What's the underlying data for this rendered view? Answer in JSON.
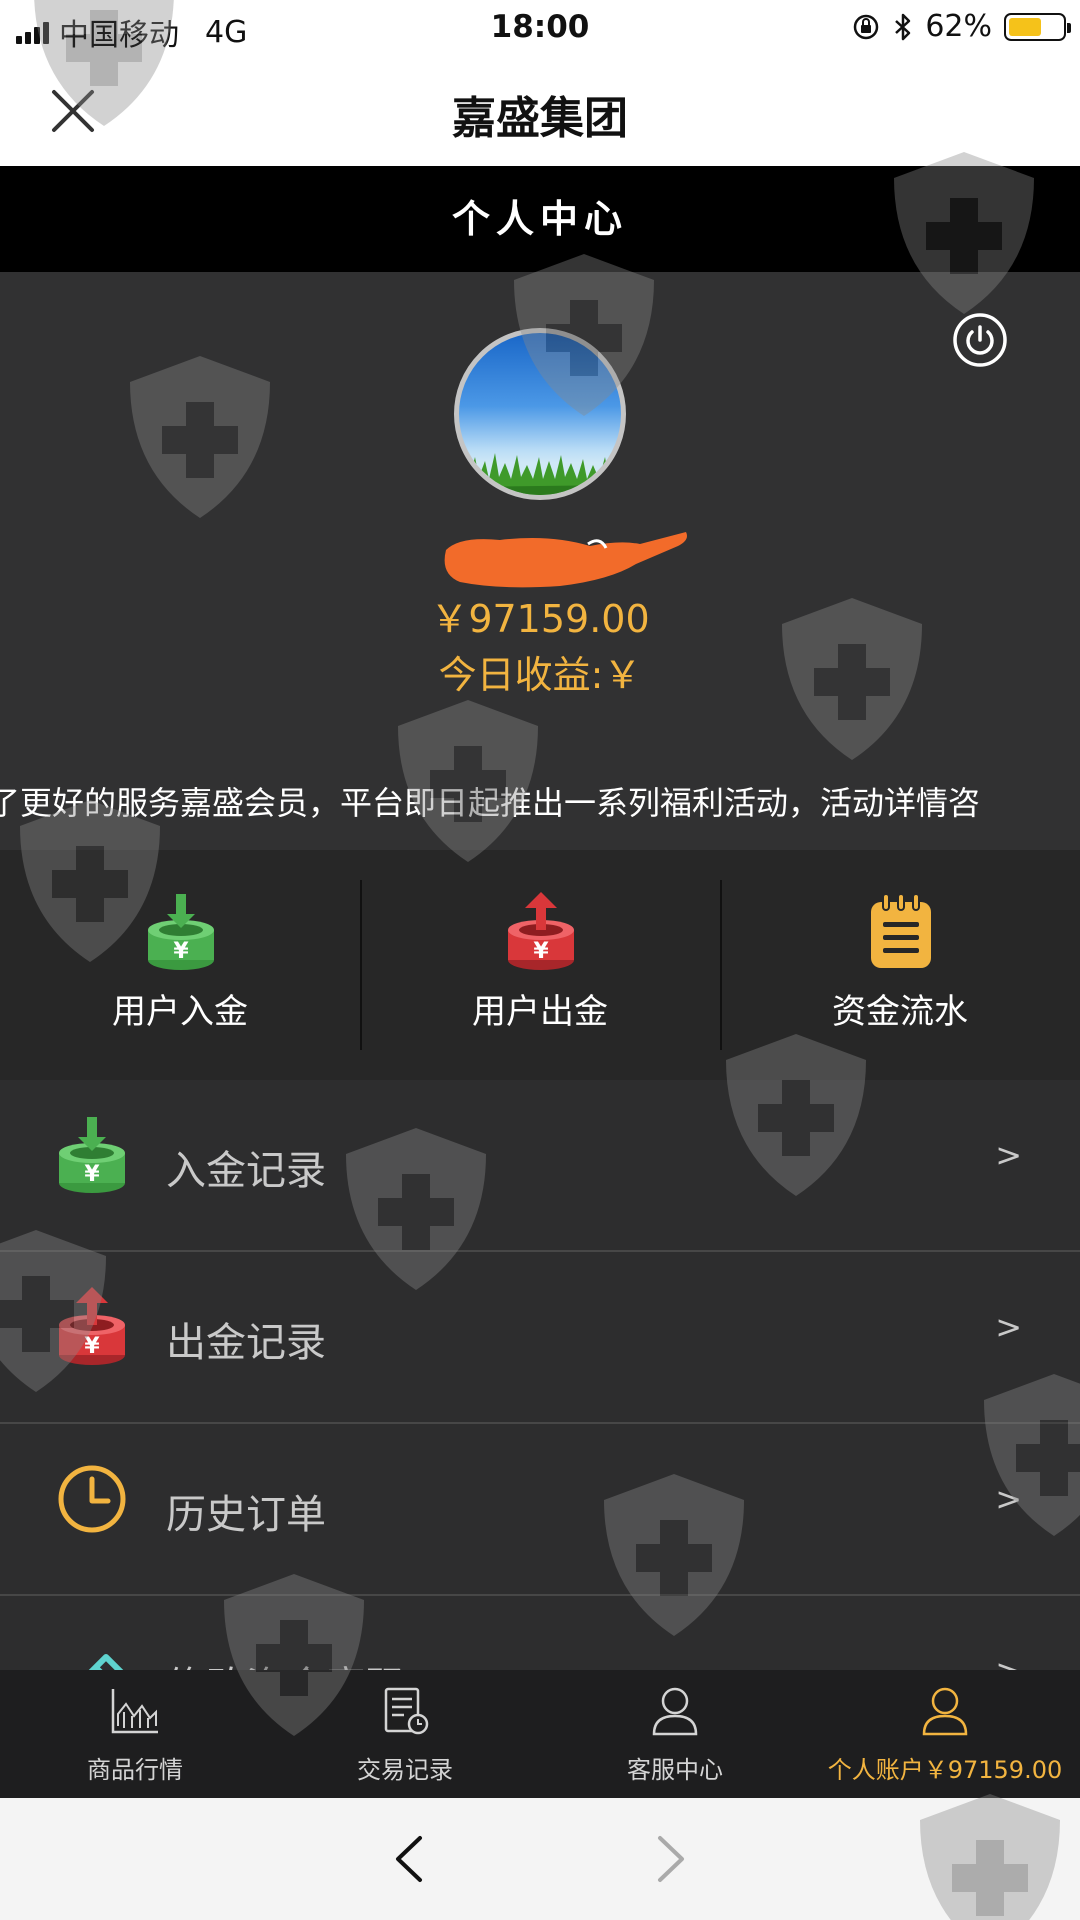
{
  "status_bar": {
    "carrier": "中国移动",
    "network": "4G",
    "time": "18:00",
    "battery": "62%",
    "battery_level": 0.62,
    "icons": [
      "signal-icon",
      "orientation-lock-icon",
      "bluetooth-icon",
      "battery-icon"
    ]
  },
  "nav": {
    "title": "嘉盛集团",
    "close_icon": "close-icon"
  },
  "page": {
    "title": "个人中心"
  },
  "profile": {
    "balance": "￥97159.00",
    "today_earnings": "今日收益:￥",
    "power_icon": "power-icon"
  },
  "notice": {
    "text": "了更好的服务嘉盛会员，平台即日起推出一系列福利活动，活动详情咨"
  },
  "quick_actions": [
    {
      "label": "用户入金",
      "icon": "deposit-icon"
    },
    {
      "label": "用户出金",
      "icon": "withdraw-icon"
    },
    {
      "label": "资金流水",
      "icon": "clipboard-icon"
    }
  ],
  "menu": [
    {
      "label": "入金记录",
      "arrow": ">",
      "icon": "deposit-icon"
    },
    {
      "label": "出金记录",
      "arrow": ">",
      "icon": "withdraw-icon"
    },
    {
      "label": "历史订单",
      "arrow": ">",
      "icon": "clock-icon"
    },
    {
      "label": "修改资金密码",
      "arrow": ">",
      "icon": "pencil-icon"
    }
  ],
  "tabbar": [
    {
      "label": "商品行情",
      "icon": "chart-icon"
    },
    {
      "label": "交易记录",
      "icon": "record-icon"
    },
    {
      "label": "客服中心",
      "icon": "user-icon"
    },
    {
      "label": "个人账户￥97159.00",
      "icon": "user-icon",
      "active": true
    }
  ],
  "colors": {
    "accent": "#f2b440",
    "deposit": "#4bb051",
    "withdraw": "#d9373a",
    "header": "#000000",
    "panel": "#313132"
  }
}
